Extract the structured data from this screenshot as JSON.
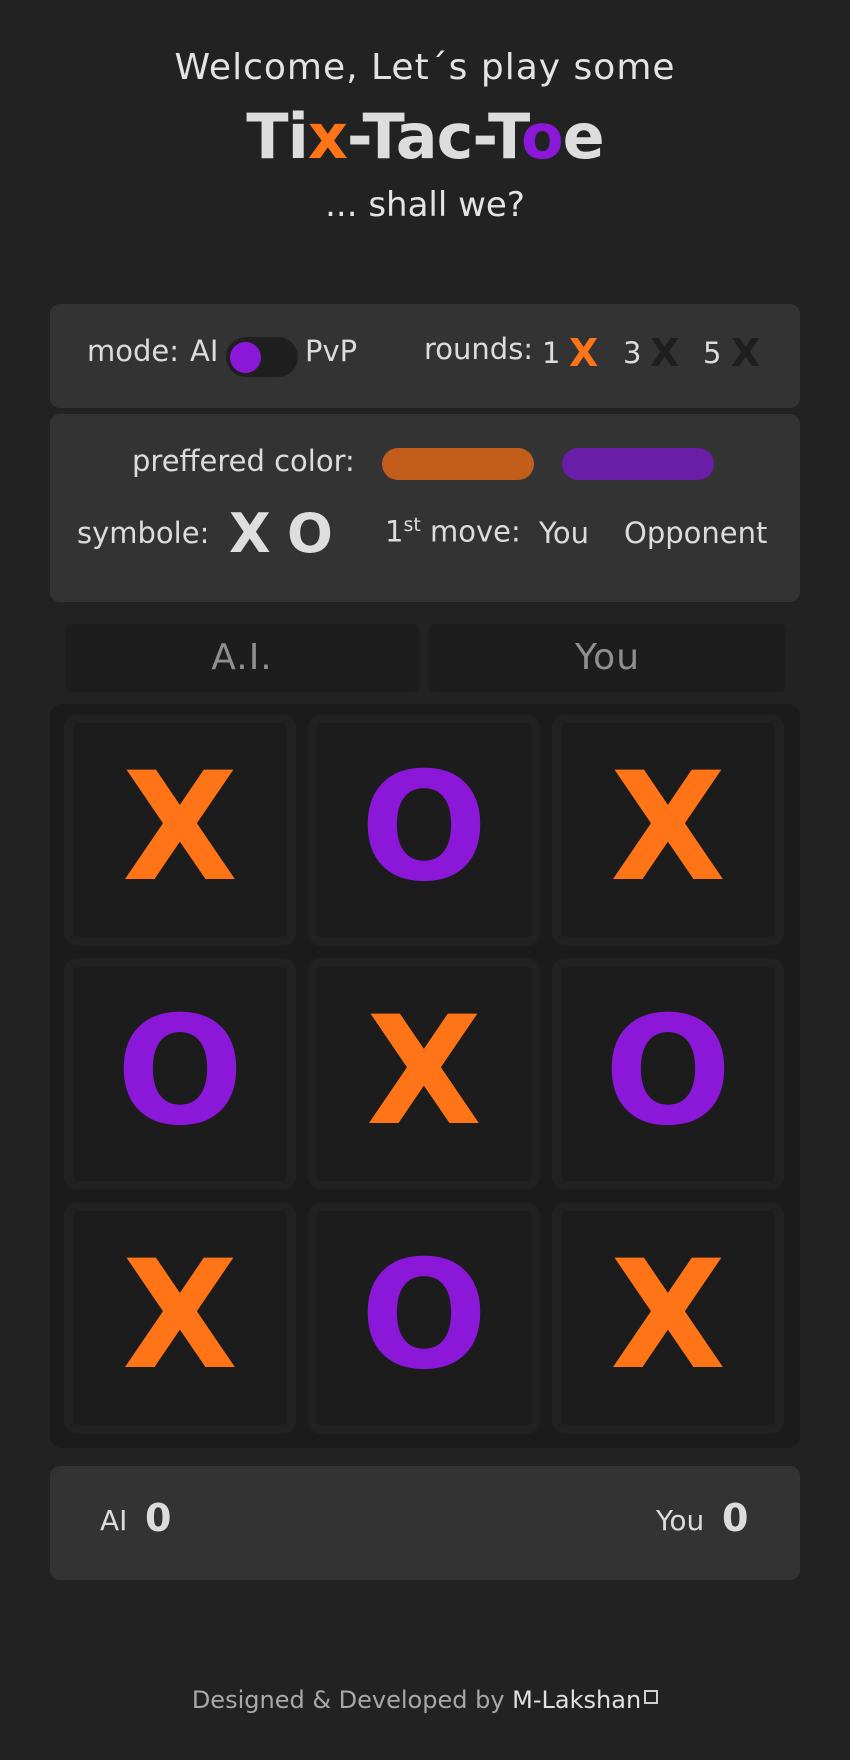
{
  "header": {
    "welcome": "Welcome, Let´s play some",
    "title_parts": [
      "Ti",
      "x",
      "-Tac-T",
      "o",
      "e"
    ],
    "subtitle": "... shall we?"
  },
  "settings": {
    "mode_label": "mode:",
    "mode_ai": "AI",
    "mode_pvp": "PvP",
    "mode_selected": "AI",
    "rounds_label": "rounds:",
    "rounds": [
      {
        "value": "1",
        "mark": "X",
        "color": "#ff7417"
      },
      {
        "value": "3",
        "mark": "X",
        "color": "#1e1e1e"
      },
      {
        "value": "5",
        "mark": "X",
        "color": "#1e1e1e"
      }
    ],
    "selected_round": "1"
  },
  "preferences": {
    "color_label": "preffered color:",
    "colors": [
      "#c25d1b",
      "#6a1ea8"
    ],
    "symbol_label": "symbole:",
    "symbol_x": "X",
    "symbol_o": "O",
    "first_move_prefix": "1",
    "first_move_sup": "st",
    "first_move_suffix": " move:",
    "first_you": "You",
    "first_opponent": "Opponent"
  },
  "turn": {
    "left": "A.I.",
    "right": "You"
  },
  "board": {
    "cells": [
      "X",
      "O",
      "X",
      "O",
      "X",
      "O",
      "X",
      "O",
      "X"
    ],
    "x_color": "#ff7417",
    "o_color": "#8b18d8"
  },
  "score": {
    "ai_label": "AI",
    "ai_value": "0",
    "you_label": "You",
    "you_value": "0"
  },
  "footer": {
    "text": "Designed & Developed by ",
    "author": "M-Lakshan",
    "link_icon": "external-link-icon"
  }
}
